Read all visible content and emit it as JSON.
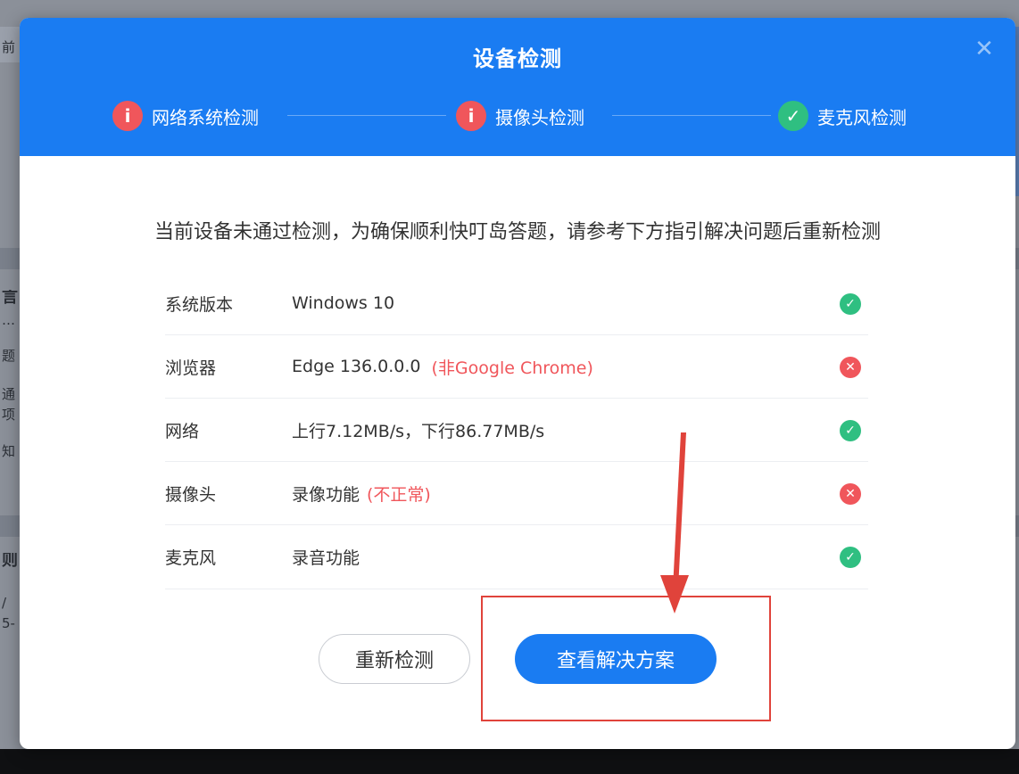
{
  "modal": {
    "title": "设备检测",
    "close_glyph": "✕",
    "steps": [
      {
        "label": "网络系统检测",
        "status": "fail",
        "glyph": "i"
      },
      {
        "label": "摄像头检测",
        "status": "fail",
        "glyph": "i"
      },
      {
        "label": "麦克风检测",
        "status": "ok",
        "glyph": "✓"
      }
    ],
    "notice": "当前设备未通过检测，为确保顺利快叮岛答题，请参考下方指引解决问题后重新检测",
    "rows": [
      {
        "name": "系统版本",
        "value": "Windows 10",
        "warn": "",
        "status": "ok",
        "glyph": "✓"
      },
      {
        "name": "浏览器",
        "value": "Edge 136.0.0.0",
        "warn": "(非Google Chrome)",
        "status": "fail",
        "glyph": "✕"
      },
      {
        "name": "网络",
        "value": "上行7.12MB/s，下行86.77MB/s",
        "warn": "",
        "status": "ok",
        "glyph": "✓"
      },
      {
        "name": "摄像头",
        "value": "录像功能",
        "warn": "(不正常)",
        "status": "fail",
        "glyph": "✕"
      },
      {
        "name": "麦克风",
        "value": "录音功能",
        "warn": "",
        "status": "ok",
        "glyph": "✓"
      }
    ],
    "buttons": {
      "recheck": "重新检测",
      "solution": "查看解决方案"
    }
  },
  "background": {
    "glyphs": [
      "前",
      "言",
      "…",
      "题",
      "通",
      "项",
      "知",
      "则",
      "/",
      "5-"
    ]
  },
  "colors": {
    "primary": "#1a7cf2",
    "success": "#2fbf81",
    "error": "#f0565b",
    "annotation": "#e0433b"
  }
}
